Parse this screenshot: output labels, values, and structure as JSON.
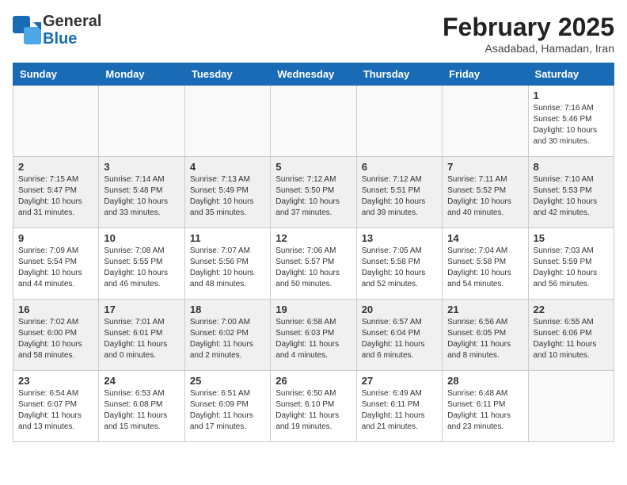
{
  "header": {
    "logo_general": "General",
    "logo_blue": "Blue",
    "month_title": "February 2025",
    "subtitle": "Asadabad, Hamadan, Iran"
  },
  "weekdays": [
    "Sunday",
    "Monday",
    "Tuesday",
    "Wednesday",
    "Thursday",
    "Friday",
    "Saturday"
  ],
  "weeks": [
    [
      {
        "day": "",
        "info": ""
      },
      {
        "day": "",
        "info": ""
      },
      {
        "day": "",
        "info": ""
      },
      {
        "day": "",
        "info": ""
      },
      {
        "day": "",
        "info": ""
      },
      {
        "day": "",
        "info": ""
      },
      {
        "day": "1",
        "info": "Sunrise: 7:16 AM\nSunset: 5:46 PM\nDaylight: 10 hours and 30 minutes."
      }
    ],
    [
      {
        "day": "2",
        "info": "Sunrise: 7:15 AM\nSunset: 5:47 PM\nDaylight: 10 hours and 31 minutes."
      },
      {
        "day": "3",
        "info": "Sunrise: 7:14 AM\nSunset: 5:48 PM\nDaylight: 10 hours and 33 minutes."
      },
      {
        "day": "4",
        "info": "Sunrise: 7:13 AM\nSunset: 5:49 PM\nDaylight: 10 hours and 35 minutes."
      },
      {
        "day": "5",
        "info": "Sunrise: 7:12 AM\nSunset: 5:50 PM\nDaylight: 10 hours and 37 minutes."
      },
      {
        "day": "6",
        "info": "Sunrise: 7:12 AM\nSunset: 5:51 PM\nDaylight: 10 hours and 39 minutes."
      },
      {
        "day": "7",
        "info": "Sunrise: 7:11 AM\nSunset: 5:52 PM\nDaylight: 10 hours and 40 minutes."
      },
      {
        "day": "8",
        "info": "Sunrise: 7:10 AM\nSunset: 5:53 PM\nDaylight: 10 hours and 42 minutes."
      }
    ],
    [
      {
        "day": "9",
        "info": "Sunrise: 7:09 AM\nSunset: 5:54 PM\nDaylight: 10 hours and 44 minutes."
      },
      {
        "day": "10",
        "info": "Sunrise: 7:08 AM\nSunset: 5:55 PM\nDaylight: 10 hours and 46 minutes."
      },
      {
        "day": "11",
        "info": "Sunrise: 7:07 AM\nSunset: 5:56 PM\nDaylight: 10 hours and 48 minutes."
      },
      {
        "day": "12",
        "info": "Sunrise: 7:06 AM\nSunset: 5:57 PM\nDaylight: 10 hours and 50 minutes."
      },
      {
        "day": "13",
        "info": "Sunrise: 7:05 AM\nSunset: 5:58 PM\nDaylight: 10 hours and 52 minutes."
      },
      {
        "day": "14",
        "info": "Sunrise: 7:04 AM\nSunset: 5:58 PM\nDaylight: 10 hours and 54 minutes."
      },
      {
        "day": "15",
        "info": "Sunrise: 7:03 AM\nSunset: 5:59 PM\nDaylight: 10 hours and 56 minutes."
      }
    ],
    [
      {
        "day": "16",
        "info": "Sunrise: 7:02 AM\nSunset: 6:00 PM\nDaylight: 10 hours and 58 minutes."
      },
      {
        "day": "17",
        "info": "Sunrise: 7:01 AM\nSunset: 6:01 PM\nDaylight: 11 hours and 0 minutes."
      },
      {
        "day": "18",
        "info": "Sunrise: 7:00 AM\nSunset: 6:02 PM\nDaylight: 11 hours and 2 minutes."
      },
      {
        "day": "19",
        "info": "Sunrise: 6:58 AM\nSunset: 6:03 PM\nDaylight: 11 hours and 4 minutes."
      },
      {
        "day": "20",
        "info": "Sunrise: 6:57 AM\nSunset: 6:04 PM\nDaylight: 11 hours and 6 minutes."
      },
      {
        "day": "21",
        "info": "Sunrise: 6:56 AM\nSunset: 6:05 PM\nDaylight: 11 hours and 8 minutes."
      },
      {
        "day": "22",
        "info": "Sunrise: 6:55 AM\nSunset: 6:06 PM\nDaylight: 11 hours and 10 minutes."
      }
    ],
    [
      {
        "day": "23",
        "info": "Sunrise: 6:54 AM\nSunset: 6:07 PM\nDaylight: 11 hours and 13 minutes."
      },
      {
        "day": "24",
        "info": "Sunrise: 6:53 AM\nSunset: 6:08 PM\nDaylight: 11 hours and 15 minutes."
      },
      {
        "day": "25",
        "info": "Sunrise: 6:51 AM\nSunset: 6:09 PM\nDaylight: 11 hours and 17 minutes."
      },
      {
        "day": "26",
        "info": "Sunrise: 6:50 AM\nSunset: 6:10 PM\nDaylight: 11 hours and 19 minutes."
      },
      {
        "day": "27",
        "info": "Sunrise: 6:49 AM\nSunset: 6:11 PM\nDaylight: 11 hours and 21 minutes."
      },
      {
        "day": "28",
        "info": "Sunrise: 6:48 AM\nSunset: 6:11 PM\nDaylight: 11 hours and 23 minutes."
      },
      {
        "day": "",
        "info": ""
      }
    ]
  ]
}
